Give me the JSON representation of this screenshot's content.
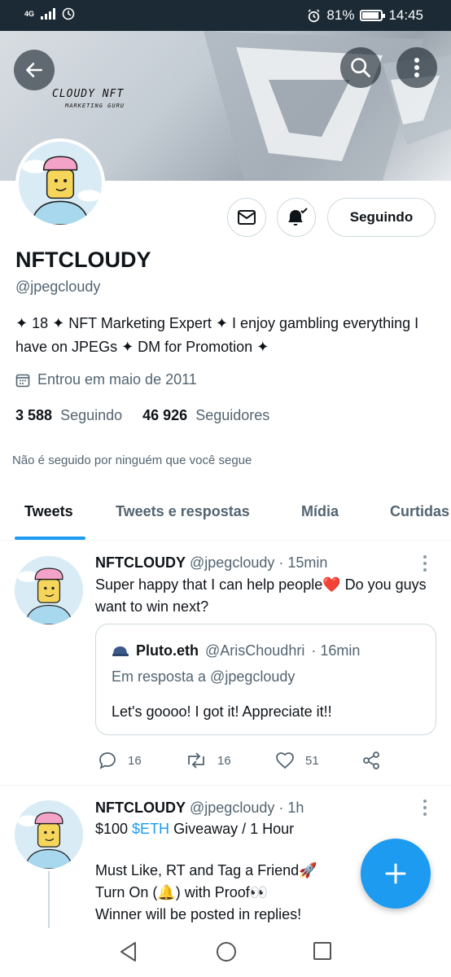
{
  "status_bar": {
    "network": "4G",
    "battery": "81%",
    "time": "14:45"
  },
  "banner": {
    "brand": "CLOUDY NFT",
    "subtitle": "MARKETING GURU"
  },
  "profile": {
    "name": "NFTCLOUDY",
    "handle": "@jpegcloudy",
    "bio": "✦ 18 ✦ NFT Marketing Expert ✦ I enjoy gambling everything I have on JPEGs ✦ DM for Promotion ✦",
    "joined": "Entrou em maio de 2011",
    "following_count": "3 588",
    "following_label": "Seguindo",
    "followers_count": "46 926",
    "followers_label": "Seguidores",
    "not_followed": "Não é seguido por ninguém que você segue",
    "follow_button": "Seguindo"
  },
  "tabs": [
    "Tweets",
    "Tweets e respostas",
    "Mídia",
    "Curtidas"
  ],
  "tweets": [
    {
      "name": "NFTCLOUDY",
      "handle": "@jpegcloudy",
      "time": "· 15min",
      "text": "Super happy that I can help people❤️ Do you guys want to win next?",
      "quote": {
        "name": "Pluto.eth",
        "handle": "@ArisChoudhri",
        "time": "· 16min",
        "reply_to": "Em resposta a @jpegcloudy",
        "text": "Let's goooo! I got it! Appreciate it!!"
      },
      "replies": "16",
      "retweets": "16",
      "likes": "51"
    },
    {
      "name": "NFTCLOUDY",
      "handle": "@jpegcloudy",
      "time": "· 1h",
      "text_prefix": "$100 ",
      "cashtag": "$ETH",
      "text_suffix": " Giveaway / 1 Hour",
      "line2": "Must Like, RT and Tag a Friend🚀",
      "line3": "Turn On (🔔) with Proof👀",
      "line4": "Winner will be posted in replies!"
    }
  ],
  "colors": {
    "accent": "#1d9bf0",
    "status_bar": "#1b2a34"
  }
}
